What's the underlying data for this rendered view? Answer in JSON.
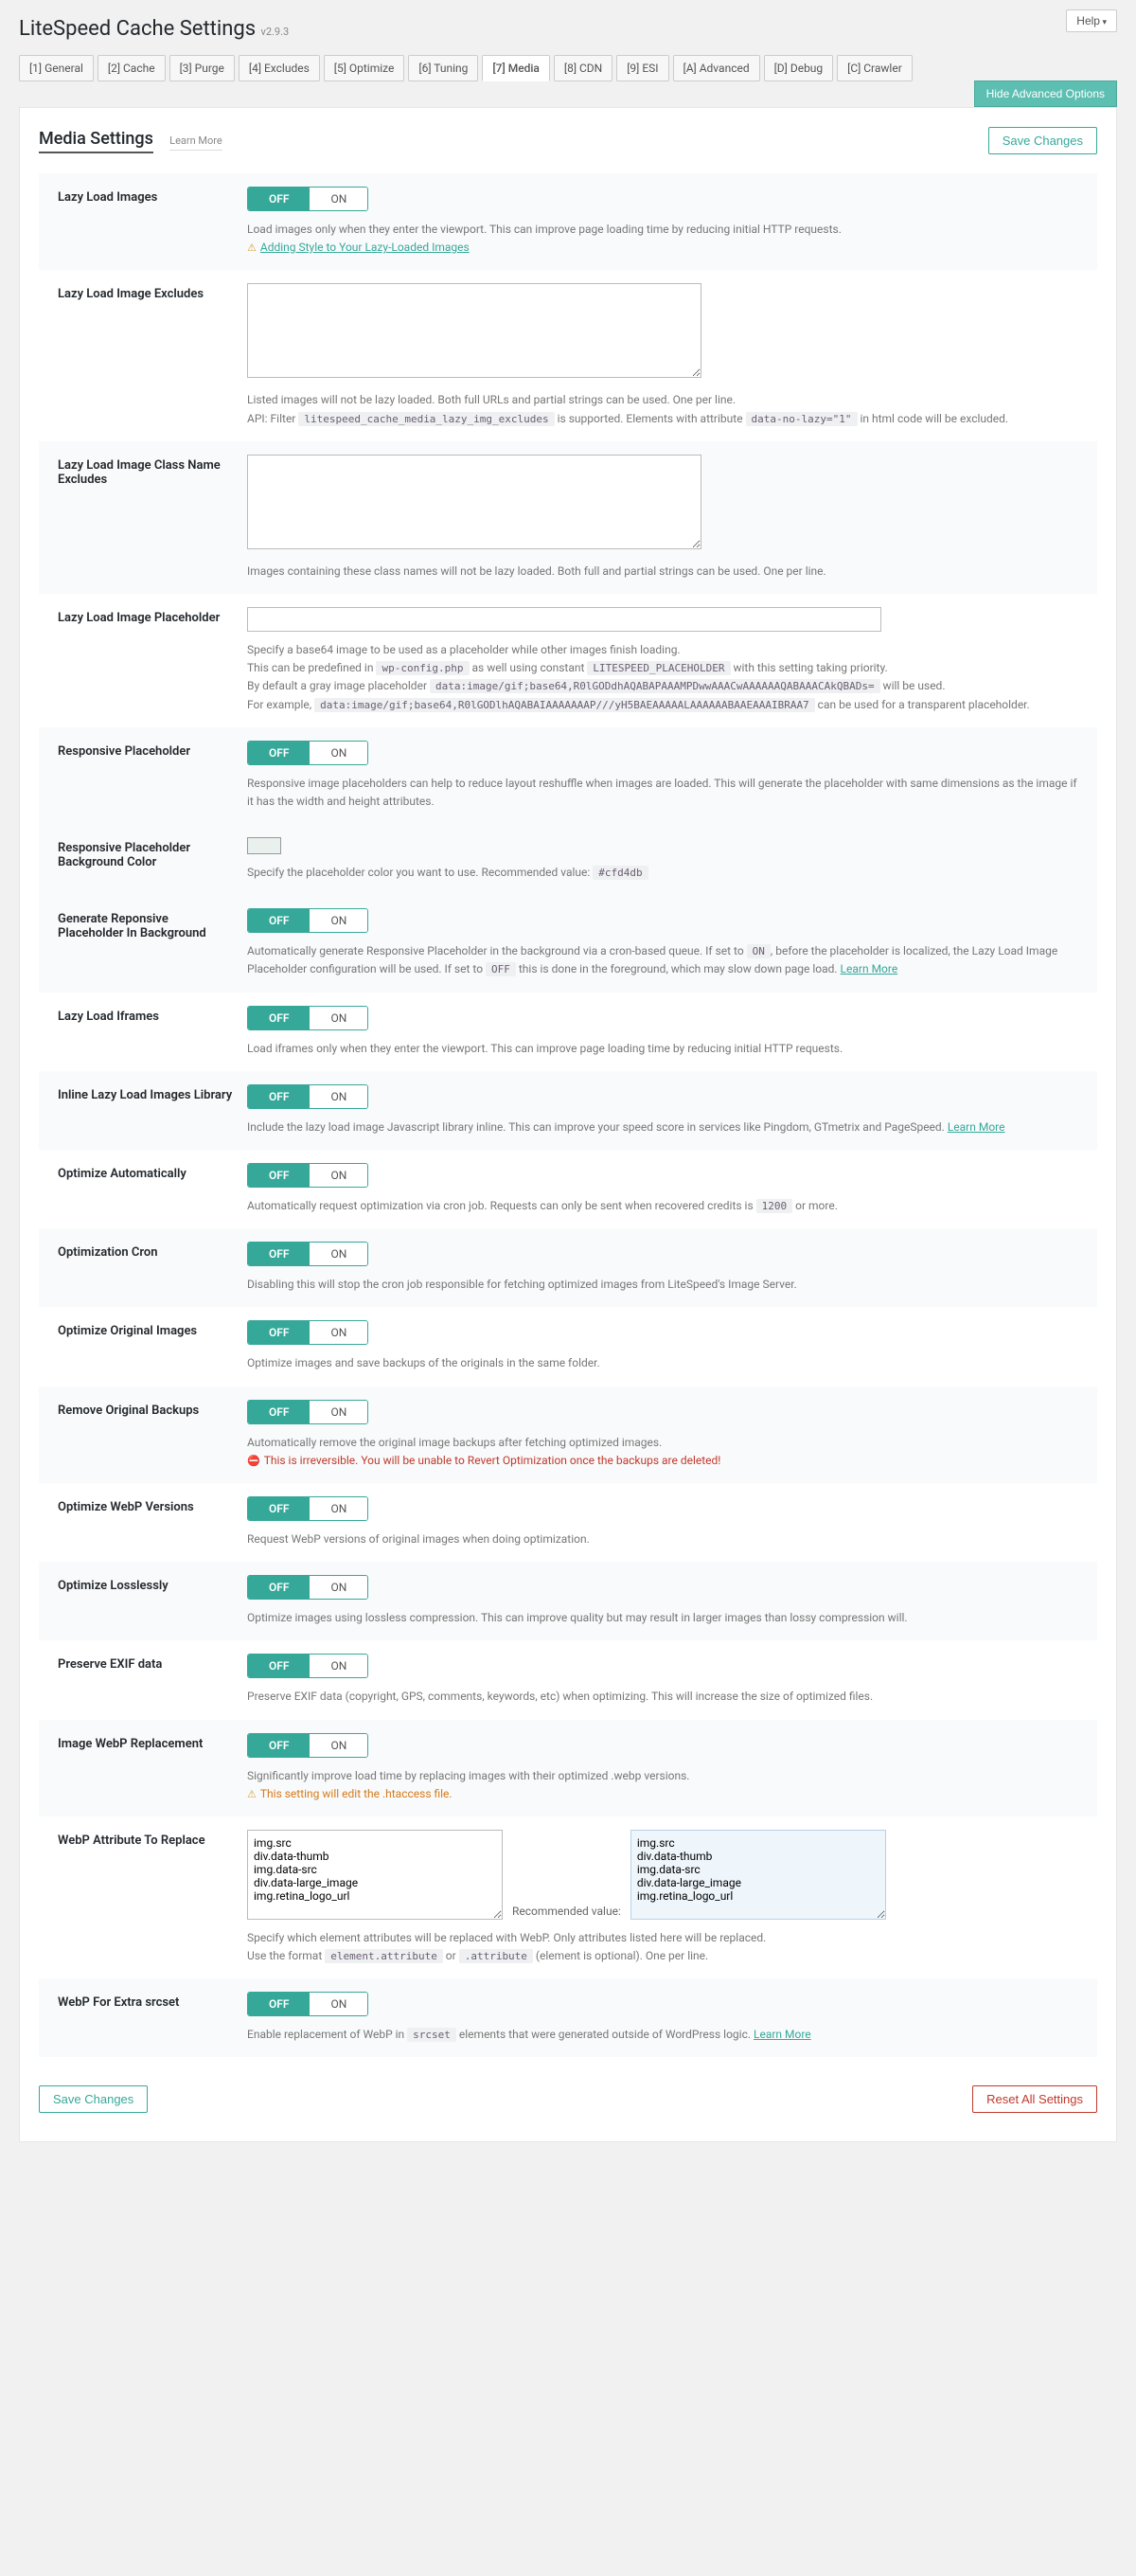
{
  "help": "Help",
  "title": "LiteSpeed Cache Settings",
  "version": "v2.9.3",
  "tabs": [
    "[1] General",
    "[2] Cache",
    "[3] Purge",
    "[4] Excludes",
    "[5] Optimize",
    "[6] Tuning",
    "[7] Media",
    "[8] CDN",
    "[9] ESI",
    "[A] Advanced",
    "[D] Debug",
    "[C] Crawler"
  ],
  "active_tab": 6,
  "hide_advanced": "Hide Advanced Options",
  "section_title": "Media Settings",
  "learn_more": "Learn More",
  "save": "Save Changes",
  "reset": "Reset All Settings",
  "off": "OFF",
  "on": "ON",
  "rows": {
    "lazy_images": {
      "label": "Lazy Load Images",
      "desc": "Load images only when they enter the viewport. This can improve page loading time by reducing initial HTTP requests.",
      "tip": "Adding Style to Your Lazy-Loaded Images"
    },
    "lazy_excl": {
      "label": "Lazy Load Image Excludes",
      "d1": "Listed images will not be lazy loaded. Both full URLs and partial strings can be used. One per line.",
      "d2a": "API: Filter ",
      "d2code": "litespeed_cache_media_lazy_img_excludes",
      "d2b": " is supported. Elements with attribute ",
      "d2code2": "data-no-lazy=\"1\"",
      "d2c": " in html code will be excluded."
    },
    "lazy_cls": {
      "label": "Lazy Load Image Class Name Excludes",
      "d": "Images containing these class names will not be lazy loaded. Both full and partial strings can be used. One per line."
    },
    "lazy_ph": {
      "label": "Lazy Load Image Placeholder",
      "d1": "Specify a base64 image to be used as a placeholder while other images finish loading.",
      "d2a": "This can be predefined in ",
      "d2c1": "wp-config.php",
      "d2b": " as well using constant ",
      "d2c2": "LITESPEED_PLACEHOLDER",
      "d2c": " with this setting taking priority.",
      "d3a": "By default a gray image placeholder ",
      "d3c": "data:image/gif;base64,R0lGODdhAQABAPAAAMPDwwAAACwAAAAAAQABAAACAkQBADs=",
      "d3b": " will be used.",
      "d4a": "For example, ",
      "d4c": "data:image/gif;base64,R0lGODlhAQABAIAAAAAAAP///yH5BAEAAAAALAAAAAABAAEAAAIBRAA7",
      "d4b": " can be used for a transparent placeholder."
    },
    "resp_ph": {
      "label": "Responsive Placeholder",
      "d": "Responsive image placeholders can help to reduce layout reshuffle when images are loaded. This will generate the placeholder with same dimensions as the image if it has the width and height attributes."
    },
    "resp_bg": {
      "label": "Responsive Placeholder Background Color",
      "d": "Specify the placeholder color you want to use. Recommended value: ",
      "code": "#cfd4db"
    },
    "gen_bg": {
      "label": "Generate Reponsive Placeholder In Background",
      "d1": "Automatically generate Responsive Placeholder in the background via a cron-based queue. If set to ",
      "c1": "ON",
      "d2": ", before the placeholder is localized, the Lazy Load Image Placeholder configuration will be used. If set to ",
      "c2": "OFF",
      "d3": " this is done in the foreground, which may slow down page load. ",
      "link": "Learn More"
    },
    "lazy_if": {
      "label": "Lazy Load Iframes",
      "d": "Load iframes only when they enter the viewport. This can improve page loading time by reducing initial HTTP requests."
    },
    "inline_lib": {
      "label": "Inline Lazy Load Images Library",
      "d": "Include the lazy load image Javascript library inline. This can improve your speed score in services like Pingdom, GTmetrix and PageSpeed. ",
      "link": "Learn More"
    },
    "opt_auto": {
      "label": "Optimize Automatically",
      "d": "Automatically request optimization via cron job. Requests can only be sent when recovered credits is ",
      "code": "1200",
      "d2": " or more."
    },
    "opt_cron": {
      "label": "Optimization Cron",
      "d": "Disabling this will stop the cron job responsible for fetching optimized images from LiteSpeed's Image Server."
    },
    "opt_orig": {
      "label": "Optimize Original Images",
      "d": "Optimize images and save backups of the originals in the same folder."
    },
    "rm_bak": {
      "label": "Remove Original Backups",
      "d": "Automatically remove the original image backups after fetching optimized images.",
      "warn": "This is irreversible. You will be unable to Revert Optimization once the backups are deleted!"
    },
    "webp_v": {
      "label": "Optimize WebP Versions",
      "d": "Request WebP versions of original images when doing optimization."
    },
    "lossless": {
      "label": "Optimize Losslessly",
      "d": "Optimize images using lossless compression. This can improve quality but may result in larger images than lossy compression will."
    },
    "exif": {
      "label": "Preserve EXIF data",
      "d": "Preserve EXIF data (copyright, GPS, comments, keywords, etc) when optimizing. This will increase the size of optimized files."
    },
    "webp_rep": {
      "label": "Image WebP Replacement",
      "d": "Significantly improve load time by replacing images with their optimized .webp versions.",
      "warn": "This setting will edit the .htaccess file."
    },
    "webp_attr": {
      "label": "WebP Attribute To Replace",
      "val": "img.src\ndiv.data-thumb\nimg.data-src\ndiv.data-large_image\nimg.retina_logo_url",
      "reclabel": "Recommended value:",
      "rec": "img.src\ndiv.data-thumb\nimg.data-src\ndiv.data-large_image\nimg.retina_logo_url",
      "d1": "Specify which element attributes will be replaced with WebP. Only attributes listed here will be replaced.",
      "d2a": "Use the format ",
      "c1": "element.attribute",
      "d2b": " or ",
      "c2": ".attribute",
      "d2c": " (element is optional). One per line."
    },
    "webp_srcset": {
      "label": "WebP For Extra srcset",
      "d": "Enable replacement of WebP in ",
      "code": "srcset",
      "d2": " elements that were generated outside of WordPress logic. ",
      "link": "Learn More"
    }
  }
}
